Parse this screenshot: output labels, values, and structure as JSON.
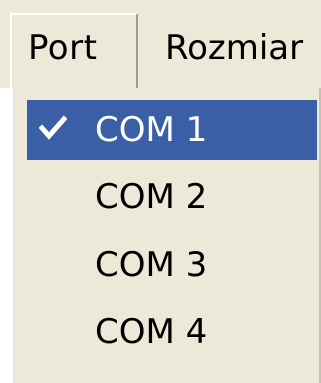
{
  "menubar": {
    "items": [
      {
        "label": "Port"
      },
      {
        "label": "Rozmiar"
      }
    ]
  },
  "port_menu": {
    "items": [
      {
        "label": "COM 1",
        "checked": true
      },
      {
        "label": "COM 2",
        "checked": false
      },
      {
        "label": "COM 3",
        "checked": false
      },
      {
        "label": "COM 4",
        "checked": false
      }
    ]
  },
  "colors": {
    "menu_background": "#ece9d8",
    "selection_highlight": "#3a5fa6",
    "selection_text": "#ffffff",
    "text": "#000000"
  },
  "icons": {
    "checked_marker": "checkmark-icon"
  }
}
